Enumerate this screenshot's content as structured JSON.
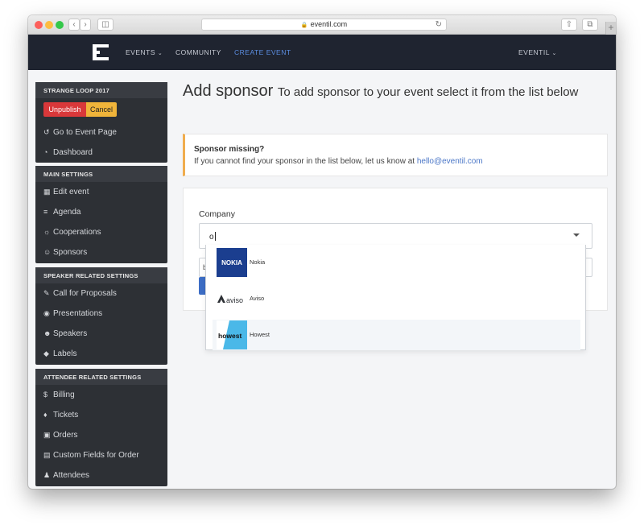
{
  "browser": {
    "url": "eventil.com"
  },
  "navbar": {
    "items": [
      "EVENTS",
      "COMMUNITY",
      "CREATE EVENT"
    ],
    "user_menu": "EVENTIL"
  },
  "sidebar": {
    "event_section": {
      "title": "STRANGE LOOP 2017",
      "unpublish_label": "Unpublish",
      "cancel_label": "Cancel",
      "items": [
        "Go to Event Page",
        "Dashboard"
      ]
    },
    "main_settings": {
      "title": "MAIN SETTINGS",
      "items": [
        "Edit event",
        "Agenda",
        "Cooperations",
        "Sponsors"
      ]
    },
    "speaker_settings": {
      "title": "SPEAKER RELATED SETTINGS",
      "items": [
        "Call for Proposals",
        "Presentations",
        "Speakers",
        "Labels"
      ]
    },
    "attendee_settings": {
      "title": "ATTENDEE RELATED SETTINGS",
      "items": [
        "Billing",
        "Tickets",
        "Orders",
        "Custom Fields for Order",
        "Attendees"
      ]
    }
  },
  "main": {
    "title": "Add sponsor",
    "subtitle": "To add sponsor to your event select it from the list below",
    "alert": {
      "title": "Sponsor missing?",
      "text": "If you cannot find your sponsor in the list below, let us know at",
      "email": "hello@eventil.com"
    },
    "form": {
      "company_label": "Company",
      "search_value": "o",
      "second_field_partial": "b"
    },
    "dropdown_options": [
      {
        "name": "Nokia",
        "logo_text": "NOKIA",
        "logo_bg": "#1b3e8f"
      },
      {
        "name": "Aviso",
        "logo_text": "aviso",
        "logo_bg": "#ffffff"
      },
      {
        "name": "Howest",
        "logo_text": "howest",
        "logo_bg": "#4ab8e8"
      }
    ]
  },
  "colors": {
    "navbar": "#1f2430",
    "nav_active": "#5b8de0",
    "sidebar": "#2d3035",
    "unpublish": "#d9383a",
    "cancel": "#f0b43a",
    "alert_border": "#f0ad4e"
  }
}
